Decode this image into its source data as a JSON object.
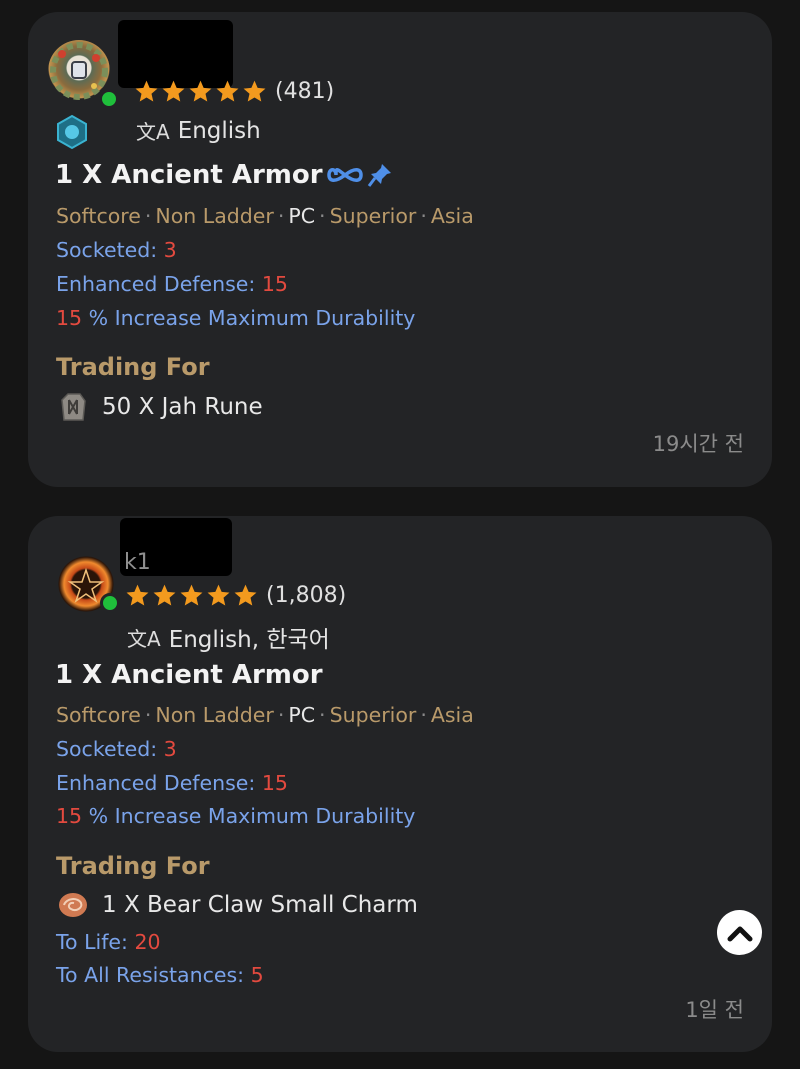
{
  "listings": [
    {
      "seller_name_partial": "",
      "rating_count": "(481)",
      "languages": "English",
      "title": "1 X Ancient Armor",
      "tags": [
        "Softcore",
        "Non Ladder",
        "PC",
        "Superior",
        "Asia"
      ],
      "stats": [
        {
          "label": "Socketed: ",
          "value": "3"
        },
        {
          "label": "Enhanced Defense: ",
          "value": "15"
        },
        {
          "value": "15",
          "label": " % Increase Maximum Durability"
        }
      ],
      "trading_for_label": "Trading For",
      "trade_item": "50 X Jah Rune",
      "trade_stats": [],
      "time": "19시간 전"
    },
    {
      "seller_name_partial": "k1",
      "rating_count": "(1,808)",
      "languages": "English, 한국어",
      "title": "1 X Ancient Armor",
      "tags": [
        "Softcore",
        "Non Ladder",
        "PC",
        "Superior",
        "Asia"
      ],
      "stats": [
        {
          "label": "Socketed: ",
          "value": "3"
        },
        {
          "label": "Enhanced Defense: ",
          "value": "15"
        },
        {
          "value": "15",
          "label": " % Increase Maximum Durability"
        }
      ],
      "trading_for_label": "Trading For",
      "trade_item": "1 X Bear Claw Small Charm",
      "trade_stats": [
        {
          "label": "To Life: ",
          "value": "20"
        },
        {
          "label": "To All Resistances: ",
          "value": "5"
        }
      ],
      "time": "1일 전"
    }
  ],
  "stars_filled": 5,
  "icons": {
    "star": "star-icon",
    "translate": "translate-icon",
    "infinity": "infinity-icon",
    "pin": "pin-icon",
    "scroll_top": "chevron-up-icon"
  },
  "colors": {
    "star": "#f39a1e",
    "tag_tan": "#b99a6a",
    "stat_blue": "#7aa3ea",
    "stat_red": "#e34a3f",
    "online": "#1fbf3b",
    "infinity_blue": "#4f8fe8"
  }
}
